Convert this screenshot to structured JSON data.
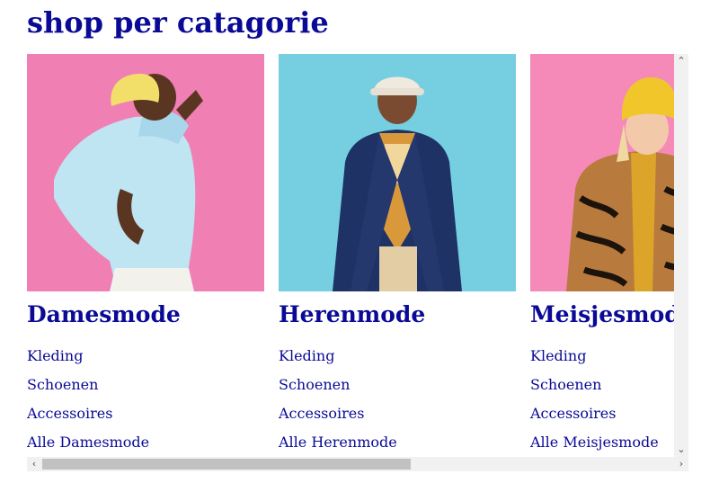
{
  "section": {
    "title": "shop per catagorie"
  },
  "categories": [
    {
      "title": "Damesmode",
      "links": [
        "Kleding",
        "Schoenen",
        "Accessoires",
        "Alle Damesmode"
      ],
      "photo_bg": "#f07fb4"
    },
    {
      "title": "Herenmode",
      "links": [
        "Kleding",
        "Schoenen",
        "Accessoires",
        "Alle Herenmode"
      ],
      "photo_bg": "#76cfe0"
    },
    {
      "title": "Meisjesmode",
      "links": [
        "Kleding",
        "Schoenen",
        "Accessoires",
        "Alle Meisjesmode"
      ],
      "photo_bg": "#f58ab9"
    }
  ],
  "scrollbars": {
    "up_icon": "chevron-up-icon",
    "down_icon": "chevron-down-icon",
    "left_icon": "chevron-left-icon",
    "right_icon": "chevron-right-icon",
    "horizontal_position": 0.45
  },
  "colors": {
    "heading": "#0a0a96",
    "link": "#0a0a96"
  }
}
